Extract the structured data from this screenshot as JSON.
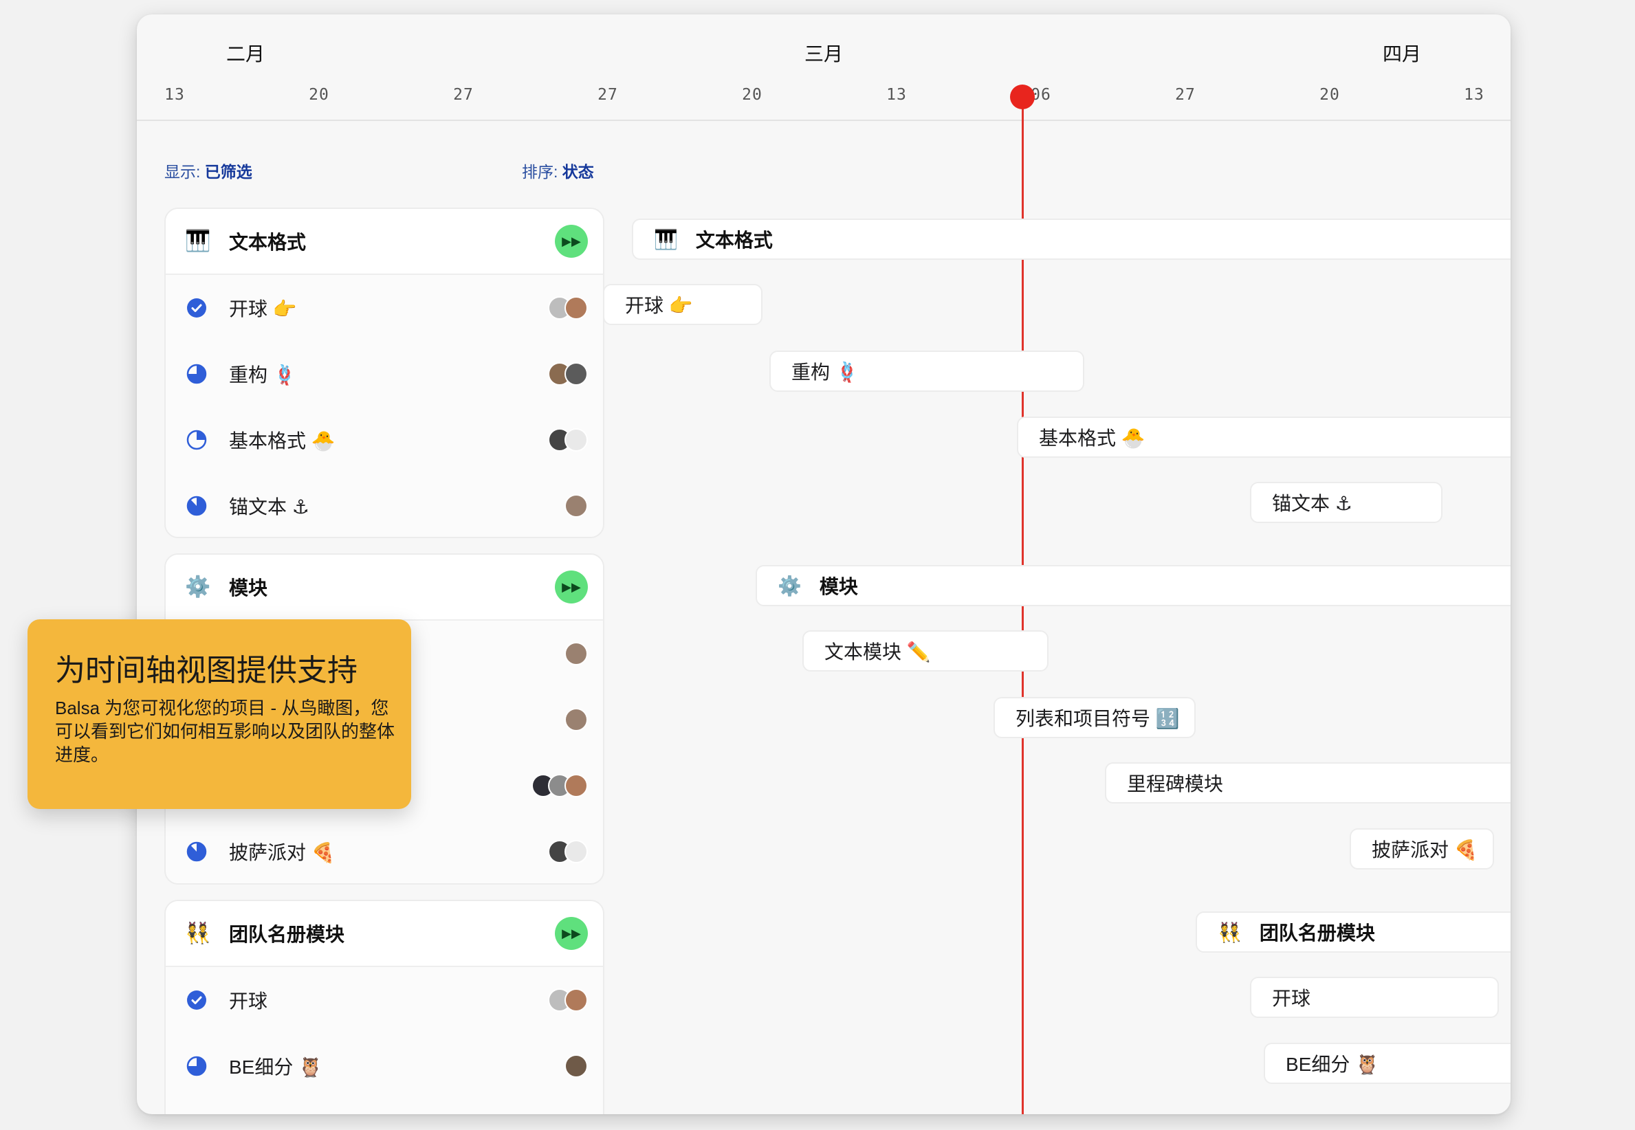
{
  "timeline": {
    "months": [
      "二月",
      "三月",
      "四月"
    ],
    "days": [
      "13",
      "20",
      "27",
      "27",
      "20",
      "13",
      "06",
      "27",
      "20",
      "13"
    ]
  },
  "controls": {
    "show_label": "显示:",
    "show_value": "已筛选",
    "sort_label": "排序:",
    "sort_value": "状态"
  },
  "groups": [
    {
      "title": "文本格式",
      "icon": "🎹",
      "rows": [
        {
          "label": "开球 👉",
          "status": "done"
        },
        {
          "label": "重构 🪢",
          "status": "half"
        },
        {
          "label": "基本格式 🐣",
          "status": "quarter"
        },
        {
          "label": "锚文本 ⚓",
          "status": "most"
        }
      ]
    },
    {
      "title": "模块",
      "icon": "⚙️",
      "rows": [
        {
          "label": "文本模块 ✏️",
          "status": "half"
        },
        {
          "label": "列表和项目符号 🔢",
          "status": "half"
        },
        {
          "label": "里程碑模块",
          "status": "half"
        },
        {
          "label": "披萨派对 🍕",
          "status": "most"
        }
      ]
    },
    {
      "title": "团队名册模块",
      "icon": "👯",
      "rows": [
        {
          "label": "开球",
          "status": "done"
        },
        {
          "label": "BE细分 🦉",
          "status": "half"
        }
      ]
    }
  ],
  "callout": {
    "title": "为时间轴视图提供支持",
    "body": "Balsa 为您可视化您的项目 - 从鸟瞰图，您可以看到它们如何相互影响以及团队的整体进度。"
  },
  "colors": {
    "accent_blue": "#2f5ed8",
    "today_red": "#e8251e",
    "play_green": "#5fe07d",
    "callout_yellow": "#f4b73c"
  }
}
